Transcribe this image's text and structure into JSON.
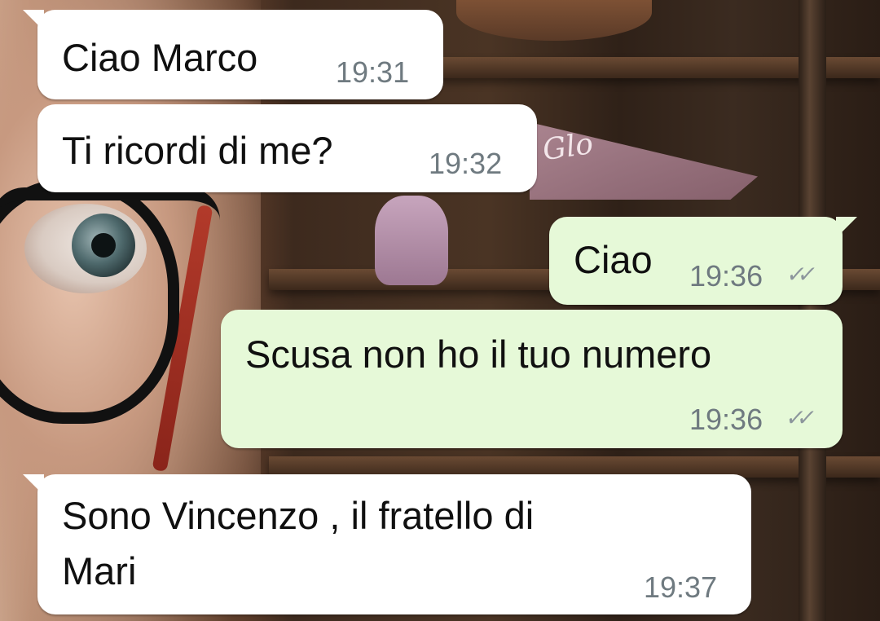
{
  "chat": {
    "messages": [
      {
        "direction": "incoming",
        "text": "Ciao Marco",
        "time": "19:31"
      },
      {
        "direction": "incoming",
        "text": "Ti ricordi di me?",
        "time": "19:32"
      },
      {
        "direction": "outgoing",
        "text": "Ciao",
        "time": "19:36",
        "status": "read"
      },
      {
        "direction": "outgoing",
        "text": "Scusa non ho il tuo numero",
        "time": "19:36",
        "status": "read"
      },
      {
        "direction": "incoming",
        "text_line1": "Sono Vincenzo , il fratello di",
        "text_line2": "Mari",
        "time": "19:37"
      }
    ]
  },
  "wallpaper": {
    "banner_text": "Glo"
  },
  "colors": {
    "incoming_bubble": "#ffffff",
    "outgoing_bubble": "#e6f9d8",
    "timestamp": "#6f7a80"
  }
}
